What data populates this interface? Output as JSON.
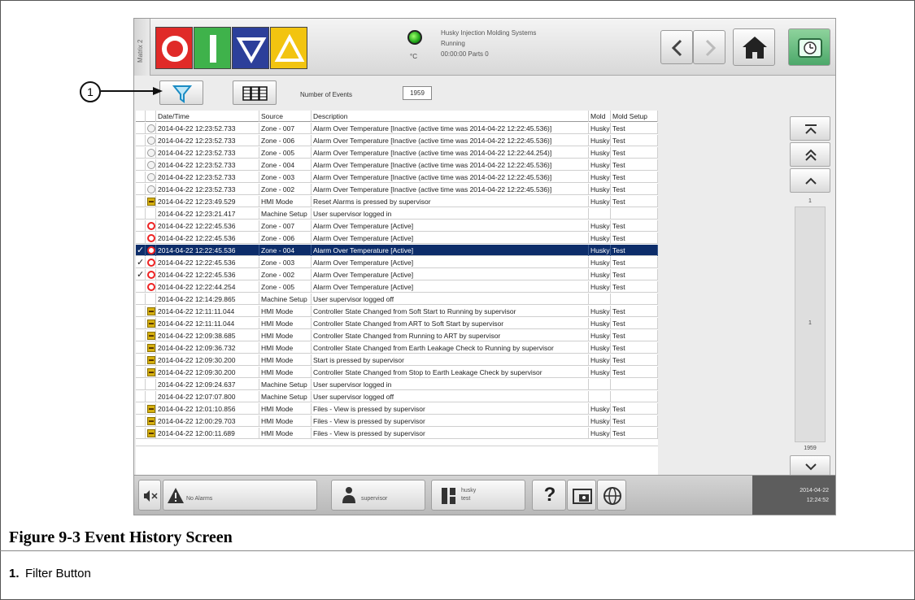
{
  "header": {
    "matrix_tab": "Matrix 2",
    "company": "Husky Injection Molding Systems",
    "status": "Running",
    "timer_parts": "00:00:00  Parts 0",
    "temp_unit": "°C"
  },
  "toolbar": {
    "events_label": "Number of Events",
    "events_count": "1959"
  },
  "table": {
    "headers": [
      "Date/Time",
      "Source",
      "Description",
      "Mold",
      "Mold Setup"
    ],
    "rows": [
      {
        "icon": "inactive",
        "check": "",
        "dt": "2014-04-22 12:23:52.733",
        "src": "Zone - 007",
        "desc": "Alarm Over Temperature [Inactive (active time was 2014-04-22 12:22:45.536)]",
        "mold": "Husky",
        "setup": "Test"
      },
      {
        "icon": "inactive",
        "check": "",
        "dt": "2014-04-22 12:23:52.733",
        "src": "Zone - 006",
        "desc": "Alarm Over Temperature [Inactive (active time was 2014-04-22 12:22:45.536)]",
        "mold": "Husky",
        "setup": "Test"
      },
      {
        "icon": "inactive",
        "check": "",
        "dt": "2014-04-22 12:23:52.733",
        "src": "Zone - 005",
        "desc": "Alarm Over Temperature [Inactive (active time was 2014-04-22 12:22:44.254)]",
        "mold": "Husky",
        "setup": "Test"
      },
      {
        "icon": "inactive",
        "check": "",
        "dt": "2014-04-22 12:23:52.733",
        "src": "Zone - 004",
        "desc": "Alarm Over Temperature [Inactive (active time was 2014-04-22 12:22:45.536)]",
        "mold": "Husky",
        "setup": "Test"
      },
      {
        "icon": "inactive",
        "check": "",
        "dt": "2014-04-22 12:23:52.733",
        "src": "Zone - 003",
        "desc": "Alarm Over Temperature [Inactive (active time was 2014-04-22 12:22:45.536)]",
        "mold": "Husky",
        "setup": "Test"
      },
      {
        "icon": "inactive",
        "check": "",
        "dt": "2014-04-22 12:23:52.733",
        "src": "Zone - 002",
        "desc": "Alarm Over Temperature [Inactive (active time was 2014-04-22 12:22:45.536)]",
        "mold": "Husky",
        "setup": "Test"
      },
      {
        "icon": "hmi",
        "check": "",
        "dt": "2014-04-22 12:23:49.529",
        "src": "HMI Mode",
        "desc": "Reset Alarms is pressed by supervisor",
        "mold": "Husky",
        "setup": "Test"
      },
      {
        "icon": "",
        "check": "",
        "dt": "2014-04-22 12:23:21.417",
        "src": "Machine Setup",
        "desc": "User supervisor logged in",
        "mold": "",
        "setup": ""
      },
      {
        "icon": "active",
        "check": "",
        "dt": "2014-04-22 12:22:45.536",
        "src": "Zone - 007",
        "desc": "Alarm Over Temperature [Active]",
        "mold": "Husky",
        "setup": "Test"
      },
      {
        "icon": "active",
        "check": "",
        "dt": "2014-04-22 12:22:45.536",
        "src": "Zone - 006",
        "desc": "Alarm Over Temperature [Active]",
        "mold": "Husky",
        "setup": "Test"
      },
      {
        "icon": "active",
        "check": "✓",
        "dt": "2014-04-22 12:22:45.536",
        "src": "Zone - 004",
        "desc": "Alarm Over Temperature [Active]",
        "mold": "Husky",
        "setup": "Test",
        "selected": true
      },
      {
        "icon": "active",
        "check": "✓",
        "dt": "2014-04-22 12:22:45.536",
        "src": "Zone - 003",
        "desc": "Alarm Over Temperature [Active]",
        "mold": "Husky",
        "setup": "Test"
      },
      {
        "icon": "active",
        "check": "✓",
        "dt": "2014-04-22 12:22:45.536",
        "src": "Zone - 002",
        "desc": "Alarm Over Temperature [Active]",
        "mold": "Husky",
        "setup": "Test"
      },
      {
        "icon": "active",
        "check": "",
        "dt": "2014-04-22 12:22:44.254",
        "src": "Zone - 005",
        "desc": "Alarm Over Temperature [Active]",
        "mold": "Husky",
        "setup": "Test"
      },
      {
        "icon": "",
        "check": "",
        "dt": "2014-04-22 12:14:29.865",
        "src": "Machine Setup",
        "desc": "User supervisor logged off",
        "mold": "",
        "setup": ""
      },
      {
        "icon": "hmi",
        "check": "",
        "dt": "2014-04-22 12:11:11.044",
        "src": "HMI Mode",
        "desc": "Controller State Changed from Soft Start to Running  by supervisor",
        "mold": "Husky",
        "setup": "Test"
      },
      {
        "icon": "hmi",
        "check": "",
        "dt": "2014-04-22 12:11:11.044",
        "src": "HMI Mode",
        "desc": "Controller State Changed from ART to Soft Start  by supervisor",
        "mold": "Husky",
        "setup": "Test"
      },
      {
        "icon": "hmi",
        "check": "",
        "dt": "2014-04-22 12:09:38.685",
        "src": "HMI Mode",
        "desc": "Controller State Changed from Running to ART  by supervisor",
        "mold": "Husky",
        "setup": "Test"
      },
      {
        "icon": "hmi",
        "check": "",
        "dt": "2014-04-22 12:09:36.732",
        "src": "HMI Mode",
        "desc": "Controller State Changed from Earth Leakage Check to Running  by supervisor",
        "mold": "Husky",
        "setup": "Test"
      },
      {
        "icon": "hmi",
        "check": "",
        "dt": "2014-04-22 12:09:30.200",
        "src": "HMI Mode",
        "desc": "Start is pressed by supervisor",
        "mold": "Husky",
        "setup": "Test"
      },
      {
        "icon": "hmi",
        "check": "",
        "dt": "2014-04-22 12:09:30.200",
        "src": "HMI Mode",
        "desc": "Controller State Changed from Stop to Earth Leakage Check  by supervisor",
        "mold": "Husky",
        "setup": "Test"
      },
      {
        "icon": "",
        "check": "",
        "dt": "2014-04-22 12:09:24.637",
        "src": "Machine Setup",
        "desc": "User supervisor logged in",
        "mold": "",
        "setup": ""
      },
      {
        "icon": "",
        "check": "",
        "dt": "2014-04-22 12:07:07.800",
        "src": "Machine Setup",
        "desc": "User supervisor logged off",
        "mold": "",
        "setup": ""
      },
      {
        "icon": "hmi",
        "check": "",
        "dt": "2014-04-22 12:01:10.856",
        "src": "HMI Mode",
        "desc": "Files - View is pressed by supervisor",
        "mold": "Husky",
        "setup": "Test"
      },
      {
        "icon": "hmi",
        "check": "",
        "dt": "2014-04-22 12:00:29.703",
        "src": "HMI Mode",
        "desc": "Files - View is pressed by supervisor",
        "mold": "Husky",
        "setup": "Test"
      },
      {
        "icon": "hmi",
        "check": "",
        "dt": "2014-04-22 12:00:11.689",
        "src": "HMI Mode",
        "desc": "Files - View is pressed by supervisor",
        "mold": "Husky",
        "setup": "Test"
      }
    ]
  },
  "scroll": {
    "top_num": "1",
    "mid_num": "1",
    "bottom_num": "1959"
  },
  "footer": {
    "alarm": "No Alarms",
    "user": "supervisor",
    "mold_name": "husky",
    "mold_setup": "test",
    "help": "?",
    "date": "2014-04-22",
    "time": "12:24:52"
  },
  "callout": {
    "number": "1"
  },
  "caption": {
    "title": "Figure 9-3   Event History Screen",
    "item_num": "1.",
    "item_text": "Filter Button"
  },
  "colors": {
    "selected_row": "#0d2d6a",
    "stop": "#e02a28",
    "start": "#3fb24b",
    "lower": "#2c3f9a",
    "warn": "#f2c410"
  }
}
